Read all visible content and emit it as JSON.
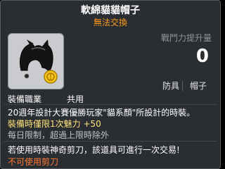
{
  "item": {
    "name": "軟綿貓貓帽子",
    "trade_status": "無法交換",
    "combat_power_label": "戰鬥力提升量",
    "combat_power_value": "0",
    "tags": [
      "防具",
      "帽子"
    ],
    "job_label": "裝備職業",
    "job_value": "共用",
    "description": "20週年設計大賽優勝玩家\"貓系顏\"所設計的時裝。",
    "effect": "裝備時僅限1次魅力  +50",
    "daily_limit": "每日限制，超過上限時除外",
    "scissors_note": "若使用時裝神奇剪刀，該道具可進行一次交易!",
    "scissors_status": "不可使用剪刀"
  },
  "colors": {
    "background": "#2a2d31",
    "trade_status": "#ff9a1f",
    "effect": "#ffe27a",
    "scissors_status": "#ff7a33"
  },
  "icons": [
    "cat-ears-hat-icon",
    "gold-coin-badge-icon"
  ]
}
